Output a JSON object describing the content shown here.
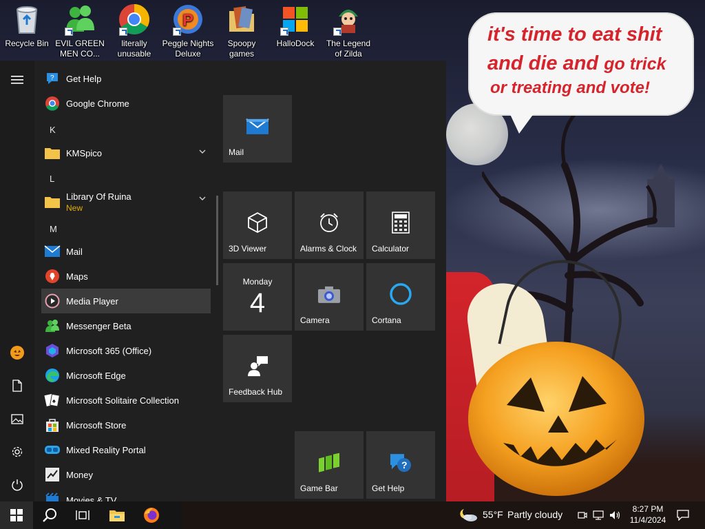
{
  "desktop": {
    "icons": [
      {
        "label_line1": "Recycle Bin",
        "label_line2": "",
        "icon": "recycle-bin-icon"
      },
      {
        "label_line1": "EVIL GREEN",
        "label_line2": "MEN CO...",
        "icon": "messenger-people-icon"
      },
      {
        "label_line1": "literally",
        "label_line2": "unusable",
        "icon": "chrome-icon"
      },
      {
        "label_line1": "Peggle Nights",
        "label_line2": "Deluxe",
        "icon": "peggle-icon"
      },
      {
        "label_line1": "Spoopy",
        "label_line2": "games",
        "icon": "folder-games-icon"
      },
      {
        "label_line1": "HalloDock",
        "label_line2": "",
        "icon": "windows-logo-icon"
      },
      {
        "label_line1": "The Legend",
        "label_line2": "of Zilda",
        "icon": "zilda-character-icon"
      }
    ],
    "speech_bubble": {
      "line1": "it's time to eat shit",
      "line2_big": "and die and",
      "line2_small": "go trick",
      "line3": "or treating and vote!"
    }
  },
  "start_menu": {
    "rail": [
      {
        "icon": "hamburger-menu-icon"
      },
      {
        "icon": "user-avatar-icon"
      },
      {
        "icon": "documents-icon"
      },
      {
        "icon": "pictures-icon"
      },
      {
        "icon": "settings-gear-icon"
      },
      {
        "icon": "power-icon"
      }
    ],
    "apps": {
      "get_help": "Get Help",
      "google_chrome": "Google Chrome",
      "letter_k": "K",
      "kmspico": "KMSpico",
      "letter_l": "L",
      "library_of_ruina": "Library Of Ruina",
      "new_badge": "New",
      "letter_m": "M",
      "mail": "Mail",
      "maps": "Maps",
      "media_player": "Media Player",
      "messenger_beta": "Messenger Beta",
      "microsoft_365": "Microsoft 365 (Office)",
      "microsoft_edge": "Microsoft Edge",
      "solitaire": "Microsoft Solitaire Collection",
      "store": "Microsoft Store",
      "mixed_reality": "Mixed Reality Portal",
      "money": "Money",
      "movies_tv": "Movies & TV"
    },
    "tiles": {
      "mail": "Mail",
      "viewer_3d": "3D Viewer",
      "alarms": "Alarms & Clock",
      "calculator": "Calculator",
      "calendar_day": "Monday",
      "calendar_date": "4",
      "camera": "Camera",
      "cortana": "Cortana",
      "feedback_hub": "Feedback Hub",
      "game_bar": "Game Bar",
      "get_help": "Get Help"
    }
  },
  "taskbar": {
    "pinned": [
      {
        "icon": "windows-start-icon"
      },
      {
        "icon": "search-icon"
      },
      {
        "icon": "task-view-icon"
      },
      {
        "icon": "file-explorer-icon"
      },
      {
        "icon": "firefox-icon"
      }
    ],
    "weather_temp": "55°F",
    "weather_desc": "Partly cloudy",
    "time": "8:27 PM",
    "date": "11/4/2024"
  },
  "colors": {
    "start_bg": "#202020",
    "tile_bg": "#333333",
    "highlight": "#3b3b3b",
    "accent_blue": "#0078d7",
    "speech_red": "#d6242d",
    "new_badge": "#e0b000"
  }
}
